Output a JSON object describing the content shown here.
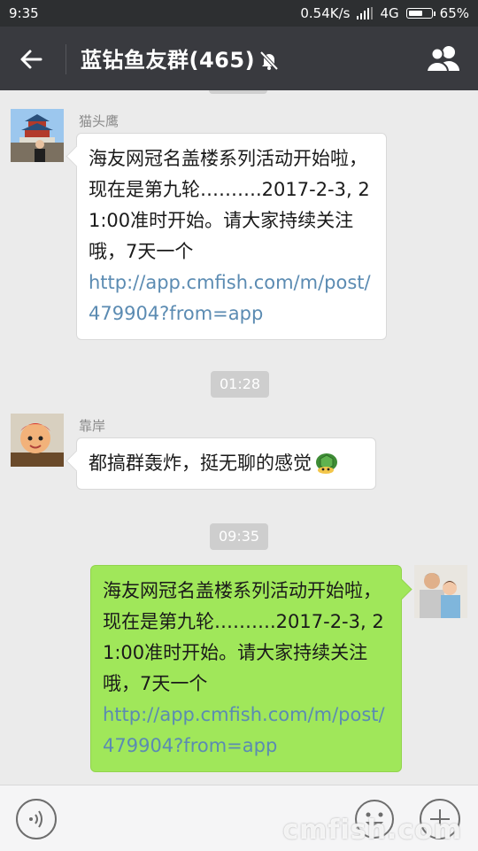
{
  "status_bar": {
    "time": "9:35",
    "speed": "0.54K/s",
    "network": "4G",
    "battery": "65%",
    "battery_level": 0.65
  },
  "header": {
    "title": "蓝钻鱼友群(465)",
    "back_icon": "arrow-left-icon",
    "mute_icon": "bell-off-icon",
    "members_icon": "group-members-icon"
  },
  "messages": [
    {
      "sender": "猫头鹰",
      "text": "海友网冠名盖楼系列活动开始啦，现在是第九轮……….2017-2-3, 21:00准时开始。请大家持续关注哦，7天一个",
      "link": "http://app.cmfish.com/m/post/479904?from=app"
    },
    {
      "timestamp": "01:28"
    },
    {
      "sender": "靠岸",
      "text": "都搞群轰炸，挺无聊的感觉",
      "emoji": "turtle-emoji"
    },
    {
      "timestamp": "09:35"
    },
    {
      "text": "海友网冠名盖楼系列活动开始啦，现在是第九轮……….2017-2-3, 21:00准时开始。请大家持续关注哦，7天一个",
      "link": "http://app.cmfish.com/m/post/479904?from=app"
    }
  ],
  "input_bar": {
    "voice_icon": "voice-icon",
    "emoji_icon": "emoji-icon",
    "plus_icon": "plus-icon",
    "watermark": "cmfish.com"
  },
  "colors": {
    "header_bg": "#393a3f",
    "chat_bg": "#ebebeb",
    "self_bubble": "#a0e75a",
    "link": "#5b8bb2"
  }
}
